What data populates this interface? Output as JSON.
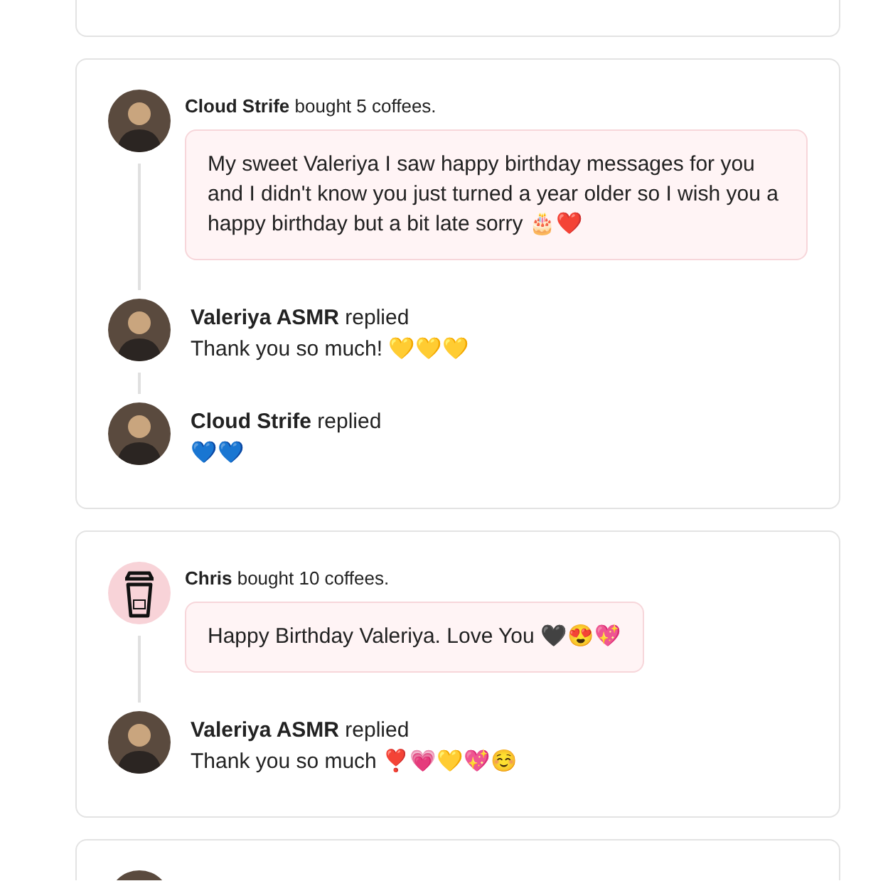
{
  "cards": [
    {
      "kind": "cut_top"
    },
    {
      "kind": "thread",
      "entries": [
        {
          "avatar": {
            "kind": "photo"
          },
          "name": "Cloud Strife",
          "action": "bought 5 coffees.",
          "message": "My sweet Valeriya I saw happy birthday messages for you and I didn't know you just turned a year older so I wish you a happy birthday but a bit late sorry 🎂❤️"
        },
        {
          "avatar": {
            "kind": "photo"
          },
          "name": "Valeriya ASMR",
          "action": "replied",
          "reply": "Thank you so much! 💛💛💛"
        },
        {
          "avatar": {
            "kind": "photo"
          },
          "name": "Cloud Strife",
          "action": "replied",
          "reply": "💙💙"
        }
      ]
    },
    {
      "kind": "thread",
      "entries": [
        {
          "avatar": {
            "kind": "cup"
          },
          "name": "Chris",
          "action": "bought 10 coffees.",
          "message": "Happy Birthday Valeriya. Love You 🖤😍💖"
        },
        {
          "avatar": {
            "kind": "photo"
          },
          "name": "Valeriya ASMR",
          "action": "replied",
          "reply": "Thank you so much ❣️💗💛💖☺️"
        }
      ]
    },
    {
      "kind": "cut_bottom",
      "avatar": {
        "kind": "photo"
      }
    }
  ]
}
